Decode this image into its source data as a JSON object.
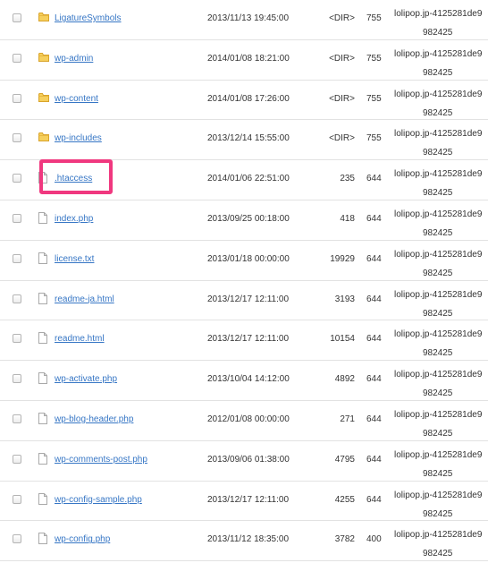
{
  "colors": {
    "link": "#3676c5",
    "highlight": "#f0387f",
    "folder": "#f2c14e"
  },
  "files": [
    {
      "icon": "folder-icon",
      "name": "LigatureSymbols",
      "date": "2013/11/13 19:45:00",
      "size": "<DIR>",
      "perm": "755",
      "owner1": "lolipop.jp-4125281de9",
      "owner2": "982425"
    },
    {
      "icon": "folder-icon",
      "name": "wp-admin",
      "date": "2014/01/08 18:21:00",
      "size": "<DIR>",
      "perm": "755",
      "owner1": "lolipop.jp-4125281de9",
      "owner2": "982425"
    },
    {
      "icon": "folder-icon",
      "name": "wp-content",
      "date": "2014/01/08 17:26:00",
      "size": "<DIR>",
      "perm": "755",
      "owner1": "lolipop.jp-4125281de9",
      "owner2": "982425"
    },
    {
      "icon": "folder-icon",
      "name": "wp-includes",
      "date": "2013/12/14 15:55:00",
      "size": "<DIR>",
      "perm": "755",
      "owner1": "lolipop.jp-4125281de9",
      "owner2": "982425"
    },
    {
      "icon": "file-icon",
      "name": ".htaccess",
      "date": "2014/01/06 22:51:00",
      "size": "235",
      "perm": "644",
      "owner1": "lolipop.jp-4125281de9",
      "owner2": "982425"
    },
    {
      "icon": "file-icon",
      "name": "index.php",
      "date": "2013/09/25 00:18:00",
      "size": "418",
      "perm": "644",
      "owner1": "lolipop.jp-4125281de9",
      "owner2": "982425"
    },
    {
      "icon": "file-icon",
      "name": "license.txt",
      "date": "2013/01/18 00:00:00",
      "size": "19929",
      "perm": "644",
      "owner1": "lolipop.jp-4125281de9",
      "owner2": "982425"
    },
    {
      "icon": "file-icon",
      "name": "readme-ja.html",
      "date": "2013/12/17 12:11:00",
      "size": "3193",
      "perm": "644",
      "owner1": "lolipop.jp-4125281de9",
      "owner2": "982425"
    },
    {
      "icon": "file-icon",
      "name": "readme.html",
      "date": "2013/12/17 12:11:00",
      "size": "10154",
      "perm": "644",
      "owner1": "lolipop.jp-4125281de9",
      "owner2": "982425"
    },
    {
      "icon": "file-icon",
      "name": "wp-activate.php",
      "date": "2013/10/04 14:12:00",
      "size": "4892",
      "perm": "644",
      "owner1": "lolipop.jp-4125281de9",
      "owner2": "982425"
    },
    {
      "icon": "file-icon",
      "name": "wp-blog-header.php",
      "date": "2012/01/08 00:00:00",
      "size": "271",
      "perm": "644",
      "owner1": "lolipop.jp-4125281de9",
      "owner2": "982425"
    },
    {
      "icon": "file-icon",
      "name": "wp-comments-post.php",
      "date": "2013/09/06 01:38:00",
      "size": "4795",
      "perm": "644",
      "owner1": "lolipop.jp-4125281de9",
      "owner2": "982425"
    },
    {
      "icon": "file-icon",
      "name": "wp-config-sample.php",
      "date": "2013/12/17 12:11:00",
      "size": "4255",
      "perm": "644",
      "owner1": "lolipop.jp-4125281de9",
      "owner2": "982425"
    },
    {
      "icon": "file-icon",
      "name": "wp-config.php",
      "date": "2013/11/12 18:35:00",
      "size": "3782",
      "perm": "400",
      "owner1": "lolipop.jp-4125281de9",
      "owner2": "982425"
    }
  ]
}
